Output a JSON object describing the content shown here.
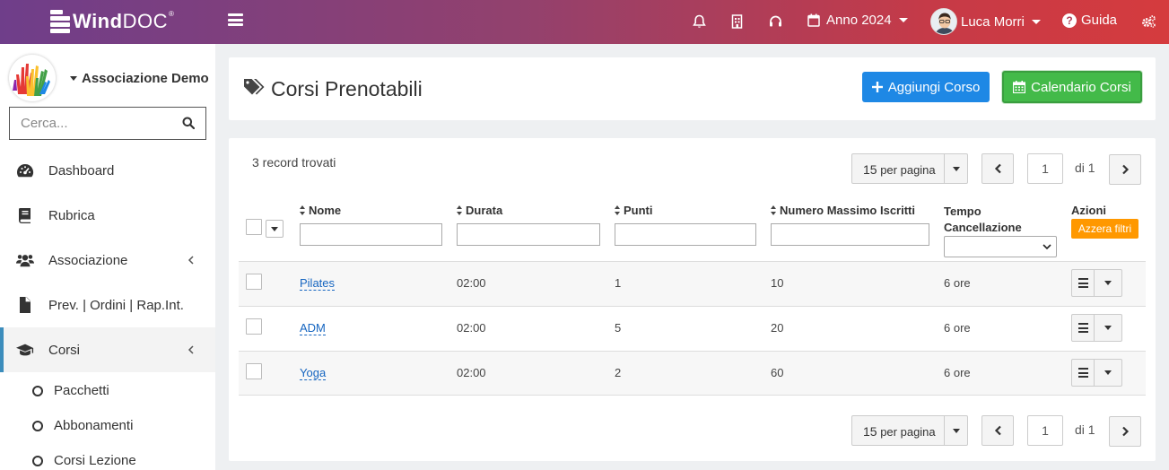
{
  "topbar": {
    "logo_text_bold": "Wind",
    "logo_text_light": "DOC",
    "logo_registered": "®",
    "year_label": "Anno 2024",
    "user_name": "Luca Morri",
    "help_label": "Guida",
    "icons": [
      "menu-icon",
      "bell-icon",
      "building-icon",
      "headset-icon",
      "calendar-icon",
      "user-avatar",
      "help-icon",
      "settings-icon"
    ]
  },
  "sidebar": {
    "org_name": "Associazione Demo",
    "search_placeholder": "Cerca...",
    "items": [
      {
        "label": "Dashboard",
        "icon": "dashboard-icon"
      },
      {
        "label": "Rubrica",
        "icon": "book-icon"
      },
      {
        "label": "Associazione",
        "icon": "users-icon"
      },
      {
        "label": "Prev. | Ordini | Rap.Int.",
        "icon": "file-icon"
      },
      {
        "label": "Corsi",
        "icon": "graduation-cap-icon",
        "active": true
      }
    ],
    "subitems": [
      {
        "label": "Pacchetti"
      },
      {
        "label": "Abbonamenti"
      },
      {
        "label": "Corsi Lezione"
      }
    ]
  },
  "header": {
    "title": "Corsi Prenotabili",
    "add_button": "Aggiungi Corso",
    "calendar_button": "Calendario Corsi"
  },
  "table": {
    "records_found": "3 record trovati",
    "per_page_value": "15",
    "per_page_suffix": "per pagina",
    "current_page": "1",
    "total_pages_label": "di 1",
    "columns": {
      "nome": "Nome",
      "durata": "Durata",
      "punti": "Punti",
      "max_iscritti": "Numero Massimo Iscritti",
      "cancellazione_1": "Tempo",
      "cancellazione_2": "Cancellazione",
      "azioni": "Azioni"
    },
    "reset_filters": "Azzera filtri",
    "rows": [
      {
        "nome": "Pilates",
        "durata": "02:00",
        "punti": "1",
        "max": "10",
        "cancellazione": "6 ore"
      },
      {
        "nome": "ADM",
        "durata": "02:00",
        "punti": "5",
        "max": "20",
        "cancellazione": "6 ore"
      },
      {
        "nome": "Yoga",
        "durata": "02:00",
        "punti": "2",
        "max": "60",
        "cancellazione": "6 ore"
      }
    ]
  },
  "colors": {
    "topbar_start": "#6f3e8a",
    "topbar_end": "#d53b3e",
    "primary_button": "#1e88e5",
    "success_button": "#43ba49",
    "reset_badge": "#ff9800",
    "link": "#1565c0",
    "active_border": "#3c8dbc"
  }
}
